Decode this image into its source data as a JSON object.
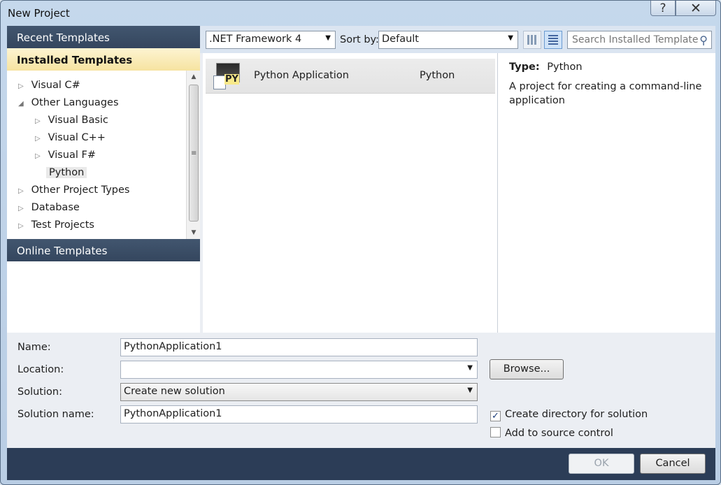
{
  "window": {
    "title": "New Project",
    "help_glyph": "?",
    "close_glyph": "✕"
  },
  "sidebar": {
    "recent_label": "Recent Templates",
    "installed_label": "Installed Templates",
    "online_label": "Online Templates",
    "tree": [
      {
        "label": "Visual C#",
        "arrow": "▷"
      },
      {
        "label": "Other Languages",
        "arrow": "◢"
      },
      {
        "label": "Visual Basic",
        "arrow": "▷"
      },
      {
        "label": "Visual C++",
        "arrow": "▷"
      },
      {
        "label": "Visual F#",
        "arrow": "▷"
      },
      {
        "label": "Python",
        "arrow": ""
      },
      {
        "label": "Other Project Types",
        "arrow": "▷"
      },
      {
        "label": "Database",
        "arrow": "▷"
      },
      {
        "label": "Test Projects",
        "arrow": "▷"
      }
    ]
  },
  "toolbar": {
    "framework": ".NET Framework 4",
    "sort_label": "Sort by:",
    "sort_value": "Default",
    "search_placeholder": "Search Installed Template"
  },
  "templates": [
    {
      "name": "Python Application",
      "language": "Python",
      "icon": "python-application-icon",
      "icon_text": "PY"
    }
  ],
  "details": {
    "type_label": "Type:",
    "type_value": "Python",
    "description": "A project for creating a command-line application"
  },
  "form": {
    "name_label": "Name:",
    "name_value": "PythonApplication1",
    "location_label": "Location:",
    "location_value": "",
    "solution_label": "Solution:",
    "solution_value": "Create new solution",
    "solution_name_label": "Solution name:",
    "solution_name_value": "PythonApplication1",
    "browse_label": "Browse...",
    "create_dir_label": "Create directory for solution",
    "create_dir_checked": true,
    "source_control_label": "Add to source control",
    "source_control_checked": false
  },
  "buttons": {
    "ok": "OK",
    "cancel": "Cancel"
  },
  "colors": {
    "header_dark": "#3b4e67",
    "installed_highlight": "#f8e7a8",
    "bottom_bar": "#2c3d57"
  }
}
